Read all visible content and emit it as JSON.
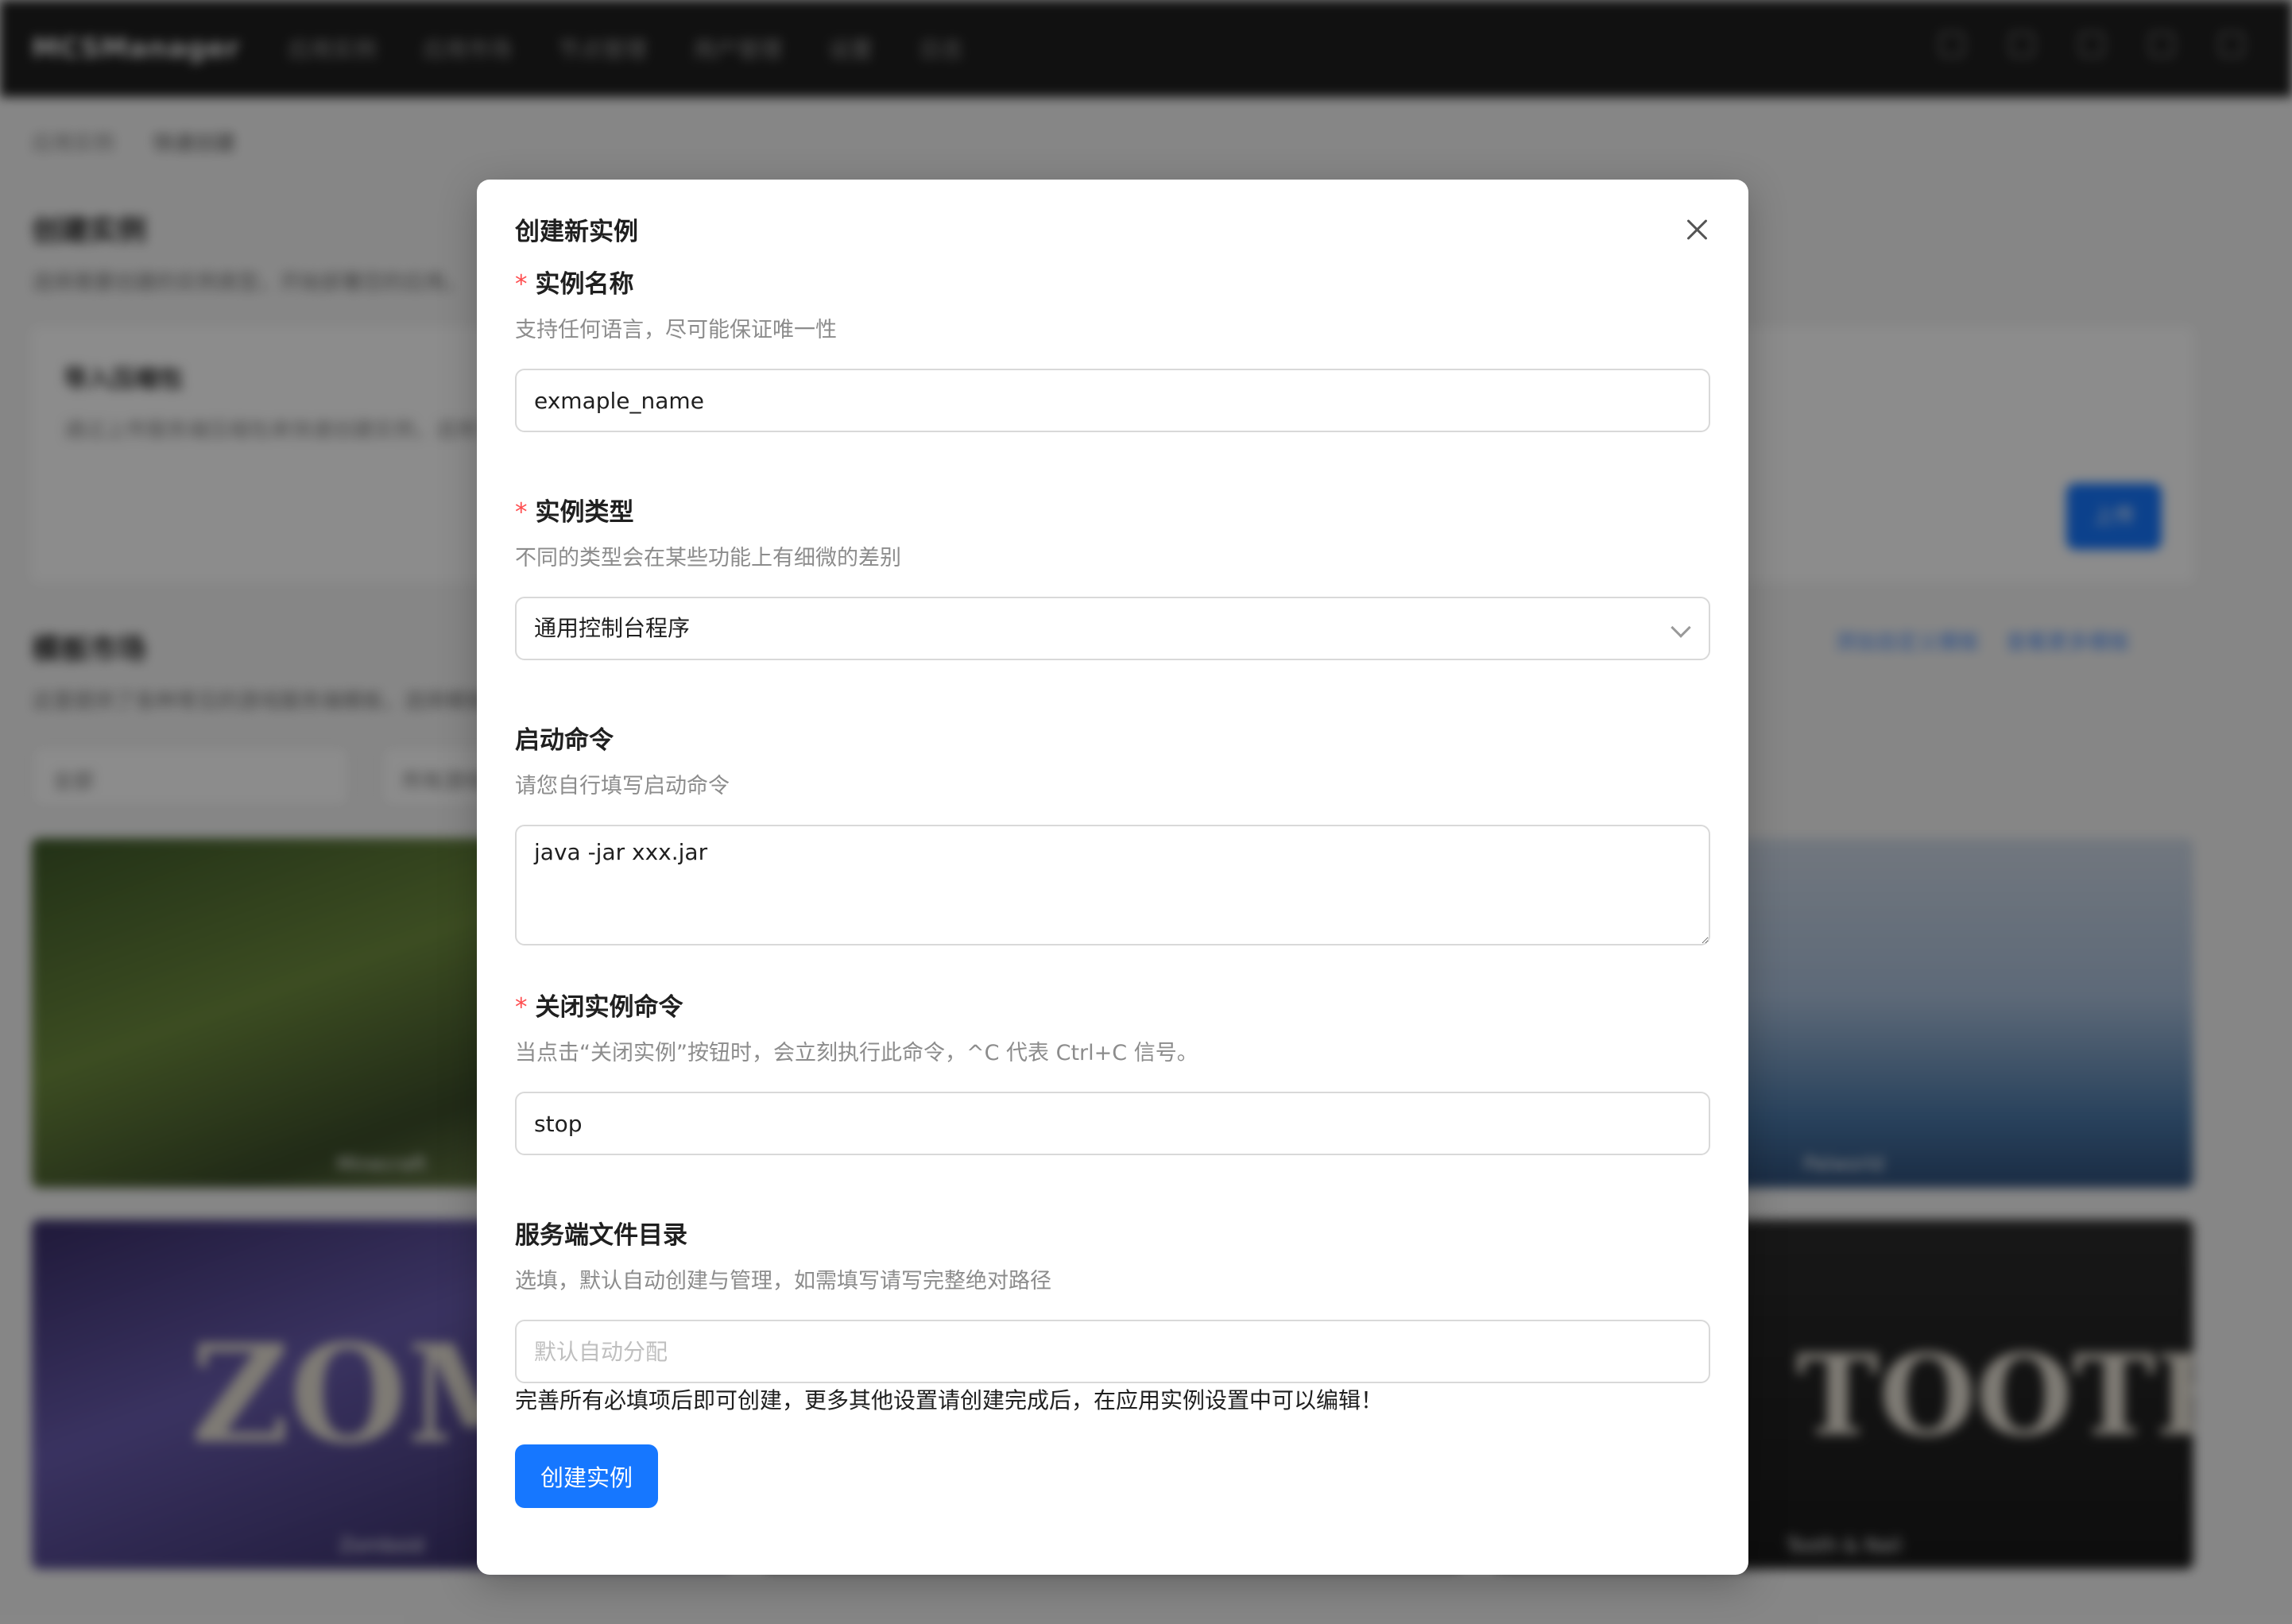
{
  "background": {
    "brand": "MCSManager",
    "nav": [
      "应用实例",
      "应用市场",
      "节点管理",
      "用户管理",
      "设置",
      "日志"
    ],
    "breadcrumb": {
      "root": "应用实例",
      "current": "快速创建"
    },
    "create_section": {
      "title": "创建实例",
      "desc": "选择需要创建的实例类型，开始部署您的应用。"
    },
    "import_card": {
      "title": "导入压缩包",
      "desc": "通过上传服务端压缩包来快速创建实例，适用于已有服务端文件的情况，系统将自动解压，您可以在创建完成后继续配置。",
      "button": "上传"
    },
    "market_section": {
      "title": "模板市场",
      "desc": "这里提供了各种常见的游戏服务端模板，选择模板即可快速部署。",
      "links": [
        "添加自定义模板",
        "查看更多模板"
      ]
    },
    "filters": [
      "全部",
      "所有游戏"
    ],
    "tiles": [
      "Minecraft",
      "",
      "Palworld",
      "Zomboid",
      "",
      "Tooth & Nail"
    ]
  },
  "modal": {
    "title": "创建新实例",
    "close_icon": "close-icon",
    "fields": {
      "name": {
        "required": "*",
        "label": "实例名称",
        "help": "支持任何语言，尽可能保证唯一性",
        "value": "exmaple_name"
      },
      "type": {
        "required": "*",
        "label": "实例类型",
        "help": "不同的类型会在某些功能上有细微的差别",
        "value": "通用控制台程序"
      },
      "start_cmd": {
        "label": "启动命令",
        "help": "请您自行填写启动命令",
        "value": "java -jar xxx.jar"
      },
      "stop_cmd": {
        "required": "*",
        "label": "关闭实例命令",
        "help": "当点击“关闭实例”按钮时，会立刻执行此命令，^C 代表 Ctrl+C 信号。",
        "value": "stop"
      },
      "cwd": {
        "label": "服务端文件目录",
        "help": "选填，默认自动创建与管理，如需填写请写完整绝对路径",
        "value": "",
        "placeholder": "默认自动分配"
      }
    },
    "notice": "完善所有必填项后即可创建，更多其他设置请创建完成后，在应用实例设置中可以编辑！",
    "submit_label": "创建实例",
    "accent_color": "#1677ff"
  }
}
